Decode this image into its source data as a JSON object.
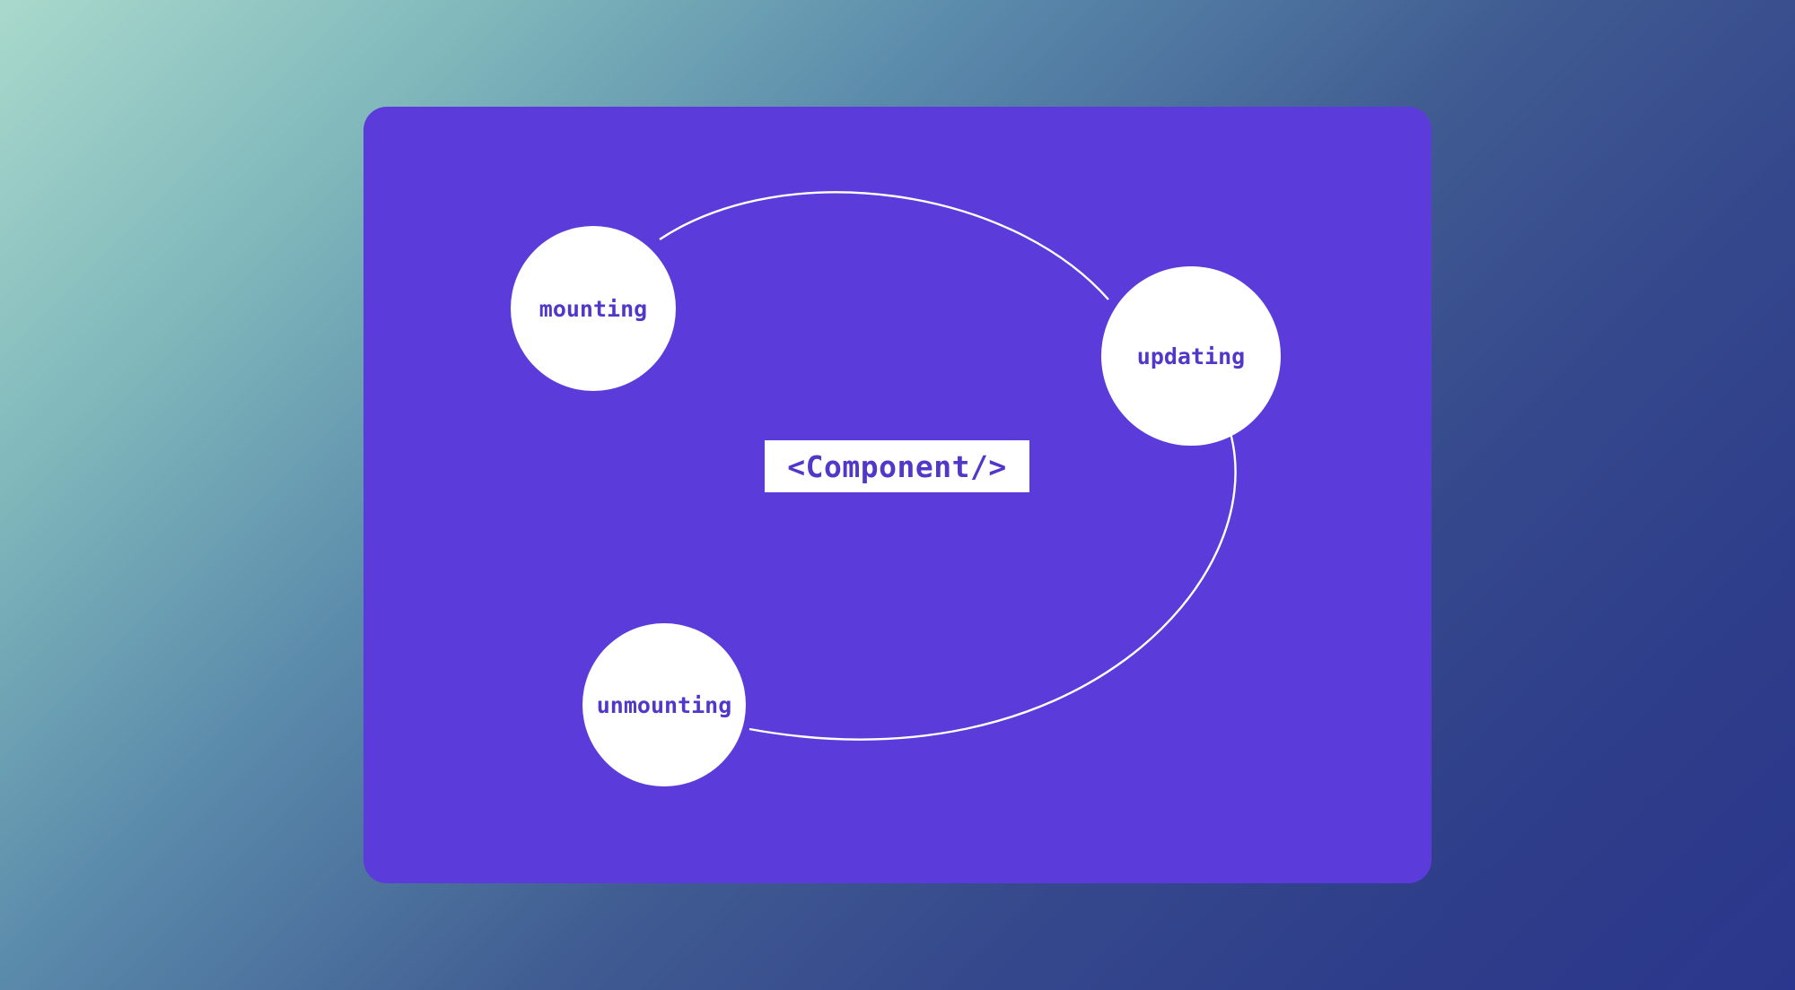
{
  "nodes": {
    "mounting": "mounting",
    "updating": "updating",
    "unmounting": "unmounting"
  },
  "center_label": "<Component/>",
  "colors": {
    "card_bg": "#5b3cdb",
    "node_bg": "#ffffff",
    "text": "#5138c9"
  }
}
